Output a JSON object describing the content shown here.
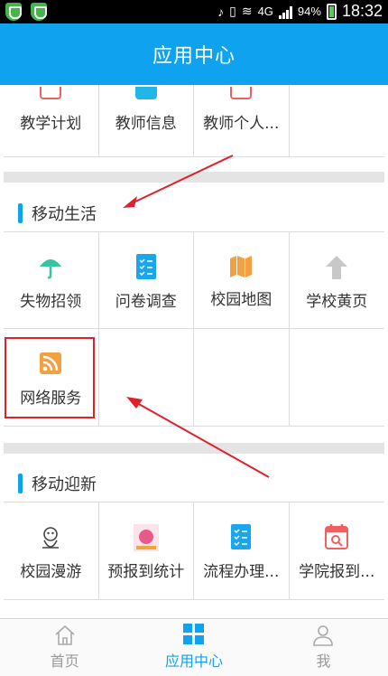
{
  "status_bar": {
    "battery": "94%",
    "time": "18:32",
    "network": "4G"
  },
  "header": {
    "title": "应用中心"
  },
  "sections": {
    "teacher": {
      "items": [
        {
          "label": "教学计划",
          "icon": "search-doc-icon",
          "color": "#f06060"
        },
        {
          "label": "教师信息",
          "icon": "read-icon",
          "color": "#20b6e8"
        },
        {
          "label": "教师个人...",
          "icon": "person-card-icon",
          "color": "#f06060"
        },
        {
          "label": "",
          "icon": "",
          "color": ""
        }
      ]
    },
    "life": {
      "title": "移动生活",
      "items": [
        {
          "label": "失物招领",
          "icon": "umbrella-icon",
          "color": "#39c3a0"
        },
        {
          "label": "问卷调查",
          "icon": "checklist-icon",
          "color": "#1aa6ee"
        },
        {
          "label": "校园地图",
          "icon": "map-icon",
          "color": "#f5a040"
        },
        {
          "label": "学校黄页",
          "icon": "up-arrow-icon",
          "color": "#bbbbbb"
        },
        {
          "label": "网络服务",
          "icon": "rss-icon",
          "color": "#f5a040"
        }
      ]
    },
    "welcome": {
      "title": "移动迎新",
      "items": [
        {
          "label": "校园漫游",
          "icon": "mascot-icon",
          "color": "#555555"
        },
        {
          "label": "预报到统计",
          "icon": "poster-icon",
          "color": "#e85a8a"
        },
        {
          "label": "流程办理...",
          "icon": "checklist-icon",
          "color": "#1aa6ee"
        },
        {
          "label": "学院报到...",
          "icon": "calendar-search-icon",
          "color": "#f06060"
        }
      ]
    }
  },
  "tabs": [
    {
      "label": "首页",
      "icon": "home-icon",
      "active": false
    },
    {
      "label": "应用中心",
      "icon": "grid-icon",
      "active": true
    },
    {
      "label": "我",
      "icon": "user-icon",
      "active": false
    }
  ],
  "colors": {
    "accent": "#0fa3ef",
    "annotation": "#e0202a"
  }
}
